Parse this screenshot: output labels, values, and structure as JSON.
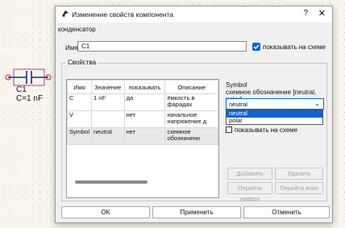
{
  "schematic": {
    "component_name": "C1",
    "component_value": "C=1 nF"
  },
  "dialog": {
    "title": "Изменение свойств компонента",
    "help_glyph": "?",
    "close_glyph": "✕",
    "group_title": "конденсатор",
    "name_label": "Имя:",
    "name_value": "C1",
    "show_on_schematic": {
      "label": "показывать на схеме",
      "checked": true
    },
    "properties_title": "Свойства",
    "table": {
      "columns": [
        "Имя",
        "Значение",
        "показывать",
        "Описание"
      ],
      "rows": [
        [
          "C",
          "1 nF",
          "да",
          "ёмкость в фарадах"
        ],
        [
          "V",
          "",
          "нет",
          "начальное напряжение д"
        ],
        [
          "Symbol",
          "neutral",
          "нет",
          "схемное обозначени"
        ]
      ]
    },
    "symbol": {
      "label": "Symbol",
      "sublabel": "схемное обозначение [neutral, polar]",
      "selected": "neutral",
      "options": [
        "neutral",
        "polar"
      ],
      "show_label": "показывать на схеме",
      "show_checked": false
    },
    "buttons": {
      "add": "Добавить",
      "delete": "Удалить",
      "move_up": "Перейти наверх",
      "move_down": "Перейти вниз",
      "ok": "OK",
      "apply": "Применить",
      "cancel": "Отменить"
    }
  },
  "colors": {
    "accent": "#0a64d6",
    "component_red": "#d02020",
    "component_blue": "#1a2a9a"
  }
}
